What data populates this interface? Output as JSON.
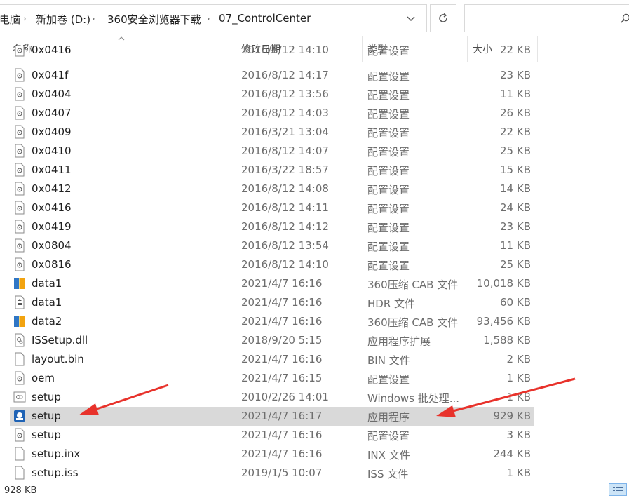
{
  "breadcrumb": {
    "items": [
      "电脑",
      "新加卷 (D:)",
      "360安全浏览器下载",
      "07_ControlCenter"
    ]
  },
  "header": {
    "name": "名称",
    "date": "修改日期",
    "type": "类型",
    "size": "大小"
  },
  "partial_row": {
    "name": "0x0416",
    "date": "2016/8/12 14:10",
    "type": "配置设置",
    "size": "22 KB"
  },
  "rows": [
    {
      "name": "0x041f",
      "date": "2016/8/12 14:17",
      "type": "配置设置",
      "size": "23 KB",
      "icon": "config-file-icon"
    },
    {
      "name": "0x0404",
      "date": "2016/8/12 13:56",
      "type": "配置设置",
      "size": "11 KB",
      "icon": "config-file-icon"
    },
    {
      "name": "0x0407",
      "date": "2016/8/12 14:03",
      "type": "配置设置",
      "size": "26 KB",
      "icon": "config-file-icon"
    },
    {
      "name": "0x0409",
      "date": "2016/3/21 13:04",
      "type": "配置设置",
      "size": "22 KB",
      "icon": "config-file-icon"
    },
    {
      "name": "0x0410",
      "date": "2016/8/12 14:07",
      "type": "配置设置",
      "size": "25 KB",
      "icon": "config-file-icon"
    },
    {
      "name": "0x0411",
      "date": "2016/3/22 18:57",
      "type": "配置设置",
      "size": "15 KB",
      "icon": "config-file-icon"
    },
    {
      "name": "0x0412",
      "date": "2016/8/12 14:08",
      "type": "配置设置",
      "size": "14 KB",
      "icon": "config-file-icon"
    },
    {
      "name": "0x0416",
      "date": "2016/8/12 14:11",
      "type": "配置设置",
      "size": "24 KB",
      "icon": "config-file-icon"
    },
    {
      "name": "0x0419",
      "date": "2016/8/12 14:12",
      "type": "配置设置",
      "size": "23 KB",
      "icon": "config-file-icon"
    },
    {
      "name": "0x0804",
      "date": "2016/8/12 13:54",
      "type": "配置设置",
      "size": "11 KB",
      "icon": "config-file-icon"
    },
    {
      "name": "0x0816",
      "date": "2016/8/12 14:10",
      "type": "配置设置",
      "size": "25 KB",
      "icon": "config-file-icon"
    },
    {
      "name": "data1",
      "date": "2021/4/7 16:16",
      "type": "360压缩 CAB 文件",
      "size": "10,018 KB",
      "icon": "archive-icon"
    },
    {
      "name": "data1",
      "date": "2021/4/7 16:16",
      "type": "HDR 文件",
      "size": "60 KB",
      "icon": "hdr-file-icon"
    },
    {
      "name": "data2",
      "date": "2021/4/7 16:16",
      "type": "360压缩 CAB 文件",
      "size": "93,456 KB",
      "icon": "archive-icon"
    },
    {
      "name": "ISSetup.dll",
      "date": "2018/9/20 5:15",
      "type": "应用程序扩展",
      "size": "1,588 KB",
      "icon": "dll-file-icon"
    },
    {
      "name": "layout.bin",
      "date": "2021/4/7 16:16",
      "type": "BIN 文件",
      "size": "2 KB",
      "icon": "blank-file-icon"
    },
    {
      "name": "oem",
      "date": "2021/4/7 16:15",
      "type": "配置设置",
      "size": "1 KB",
      "icon": "config-file-icon"
    },
    {
      "name": "setup",
      "date": "2010/2/26 14:01",
      "type": "Windows 批处理...",
      "size": "1 KB",
      "icon": "batch-file-icon"
    },
    {
      "name": "setup",
      "date": "2021/4/7 16:17",
      "type": "应用程序",
      "size": "929 KB",
      "icon": "setup-app-icon",
      "selected": true
    },
    {
      "name": "setup",
      "date": "2021/4/7 16:16",
      "type": "配置设置",
      "size": "3 KB",
      "icon": "config-file-icon"
    },
    {
      "name": "setup.inx",
      "date": "2021/4/7 16:16",
      "type": "INX 文件",
      "size": "244 KB",
      "icon": "blank-file-icon"
    },
    {
      "name": "setup.iss",
      "date": "2019/1/5 10:07",
      "type": "ISS 文件",
      "size": "1 KB",
      "icon": "blank-file-icon"
    }
  ],
  "status": {
    "selection_size": "928 KB"
  },
  "colors": {
    "selected_row": "#d9d9d9",
    "arrow": "#e8322b"
  }
}
